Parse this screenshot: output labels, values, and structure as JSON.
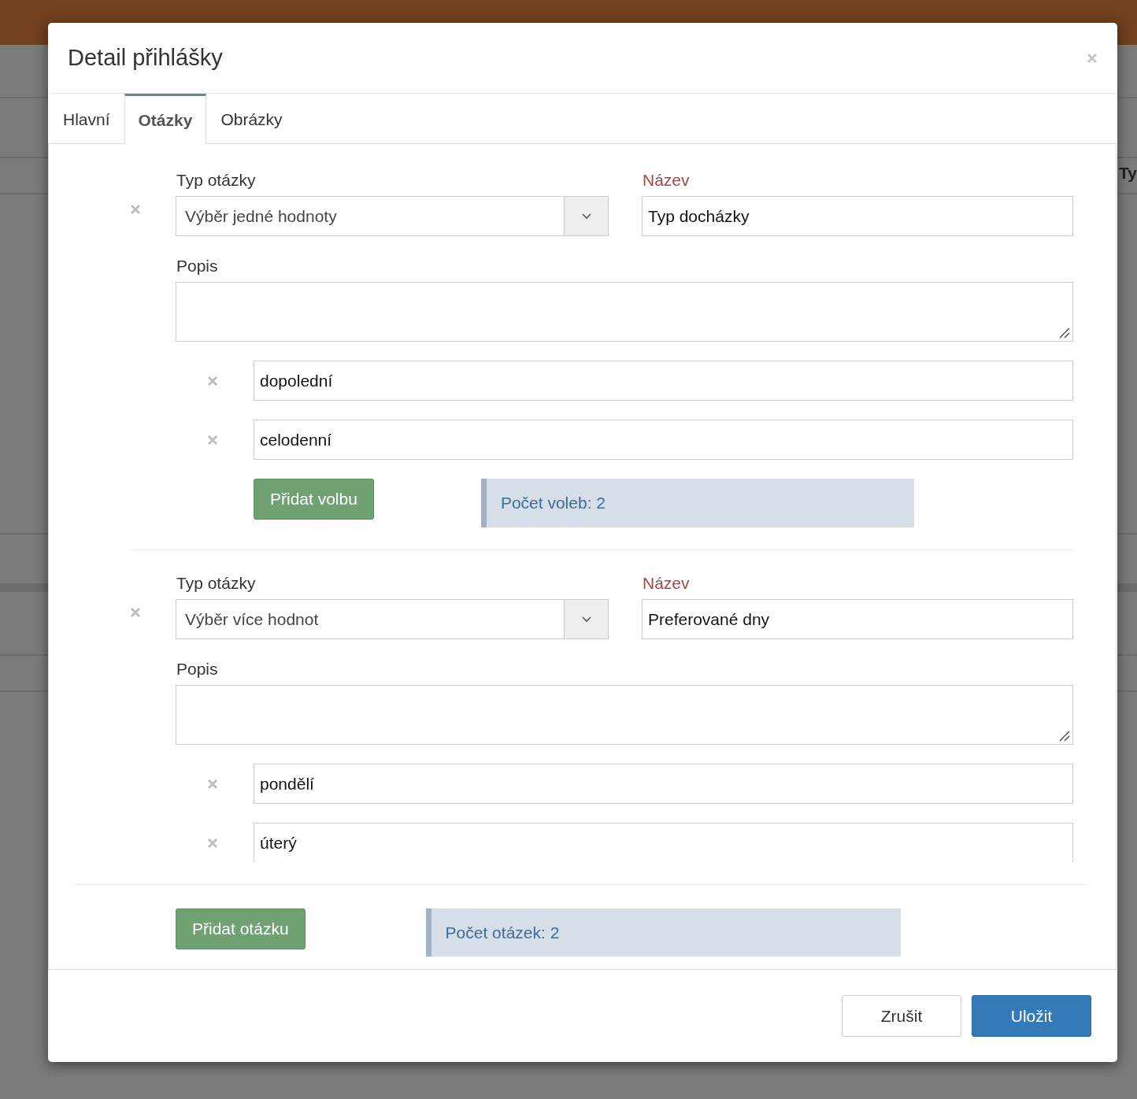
{
  "background_page": {
    "column_header": "Ty"
  },
  "dialog": {
    "title": "Detail přihlášky"
  },
  "tabs": [
    {
      "label": "Hlavní",
      "selected": false
    },
    {
      "label": "Otázky",
      "selected": true
    },
    {
      "label": "Obrázky",
      "selected": false
    }
  ],
  "questions": [
    {
      "type_label": "Typ otázky",
      "type_value": "Výběr jedné hodnoty",
      "name_label": "Název",
      "name_value": "Typ docházky",
      "description_label": "Popis",
      "options": [
        "dopolední",
        "celodenní"
      ],
      "add_option_button": "Přidat volbu",
      "option_count": "Počet voleb: 2"
    },
    {
      "type_label": "Typ otázky",
      "type_value": "Výběr více hodnot",
      "name_label": "Název",
      "name_value": "Preferované dny",
      "description_label": "Popis",
      "options": [
        "pondělí",
        "úterý"
      ]
    }
  ],
  "add_question_button": "Přidat otázku",
  "question_count": "Počet otázek: 2",
  "buttons": [
    {
      "label": "Zrušit",
      "kind": "default"
    },
    {
      "label": "Uložit",
      "kind": "primary"
    }
  ]
}
